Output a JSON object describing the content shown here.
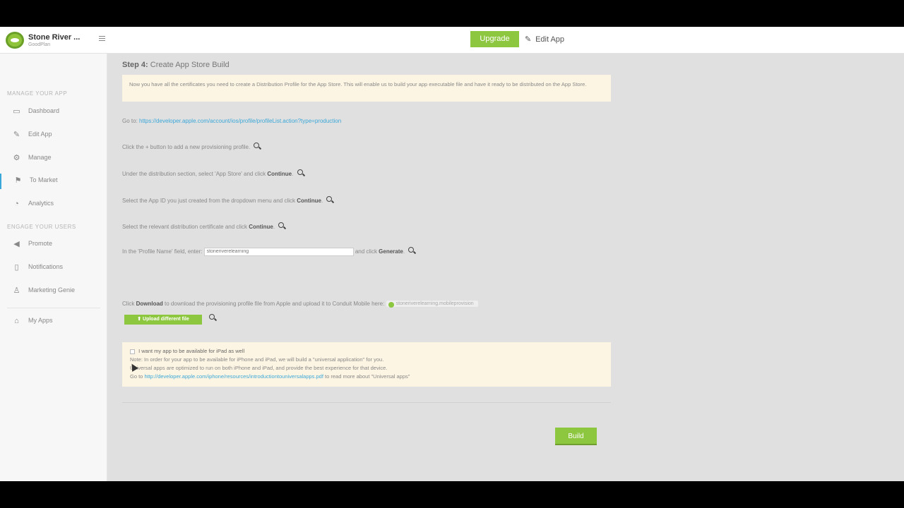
{
  "header": {
    "brand_name": "Stone River ...",
    "brand_sub": "GoodPlan",
    "upgrade_label": "Upgrade",
    "edit_app_label": "Edit App"
  },
  "sidebar": {
    "section1": "MANAGE YOUR APP",
    "section2": "ENGAGE YOUR USERS",
    "items": [
      {
        "label": "Dashboard",
        "icon": "monitor-icon"
      },
      {
        "label": "Edit App",
        "icon": "pencil-icon"
      },
      {
        "label": "Manage",
        "icon": "gear-icon"
      },
      {
        "label": "To Market",
        "icon": "flag-icon"
      },
      {
        "label": "Analytics",
        "icon": "chart-icon"
      },
      {
        "label": "Promote",
        "icon": "megaphone-icon"
      },
      {
        "label": "Notifications",
        "icon": "bell-icon"
      },
      {
        "label": "Marketing Genie",
        "icon": "genie-icon"
      },
      {
        "label": "My Apps",
        "icon": "home-icon"
      }
    ]
  },
  "main": {
    "step_label": "Step 4:",
    "step_title": "Create App Store Build",
    "notice": "Now you have all the certificates you need to create a Distribution Profile for the App Store. This will enable us to build your app executable file and have it ready to be distributed on the App Store.",
    "goto_label": "Go to:",
    "goto_link": "https://developer.apple.com/account/ios/profile/profileList.action?type=production",
    "step_add": "Click the + button to add a new provisioning profile.",
    "step_dist_pre": "Under the distribution section, select 'App Store' and click",
    "step_appid_pre": "Select the App ID you just created from the dropdown menu and click",
    "step_cert_pre": "Select the relevant distribution certificate and click",
    "continue_label": "Continue",
    "profile_pre": "In the 'Profile Name' field, enter:",
    "profile_value": "stoneriverelearning",
    "profile_post": "and click",
    "generate_label": "Generate",
    "download_pre": "Click",
    "download_label": "Download",
    "download_post": "to download the provisioning profile file from Apple and upload it to Conduit Mobile here:",
    "uploaded_file": "stoneriverelearning.mobileprovision",
    "upload_btn": "Upload different file",
    "ipad_checkbox": "I want my app to be available for iPad as well",
    "ipad_note1": "Note: In order for your app to be available for iPhone and iPad, we will build a \"universal application\" for you.",
    "ipad_note2": "Universal apps are optimized to run on both iPhone and iPad, and provide the best experience for that device.",
    "ipad_go_to": "Go to",
    "ipad_link": "http://developer.apple.com/iphone/resources/introductiontouniversalapps.pdf",
    "ipad_link_post": "to read more about \"Universal apps\"",
    "build_label": "Build"
  }
}
